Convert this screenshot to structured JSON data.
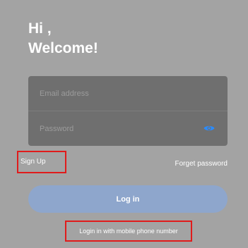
{
  "greeting": {
    "line1": "Hi ,",
    "line2": "Welcome!"
  },
  "form": {
    "email_placeholder": "Email address",
    "password_placeholder": "Password",
    "password_toggle_icon": "eye-icon"
  },
  "links": {
    "sign_up": "Sign Up",
    "forgot_password": "Forget password",
    "mobile_login": "Login in with mobile phone number"
  },
  "login_button": {
    "label": "Log in"
  },
  "colors": {
    "background": "#a3a3a3",
    "form_card": "#6f6f6f",
    "accent": "#2a8cff",
    "login_button": "#8ea6cc",
    "highlight_box": "#e01b1b"
  }
}
